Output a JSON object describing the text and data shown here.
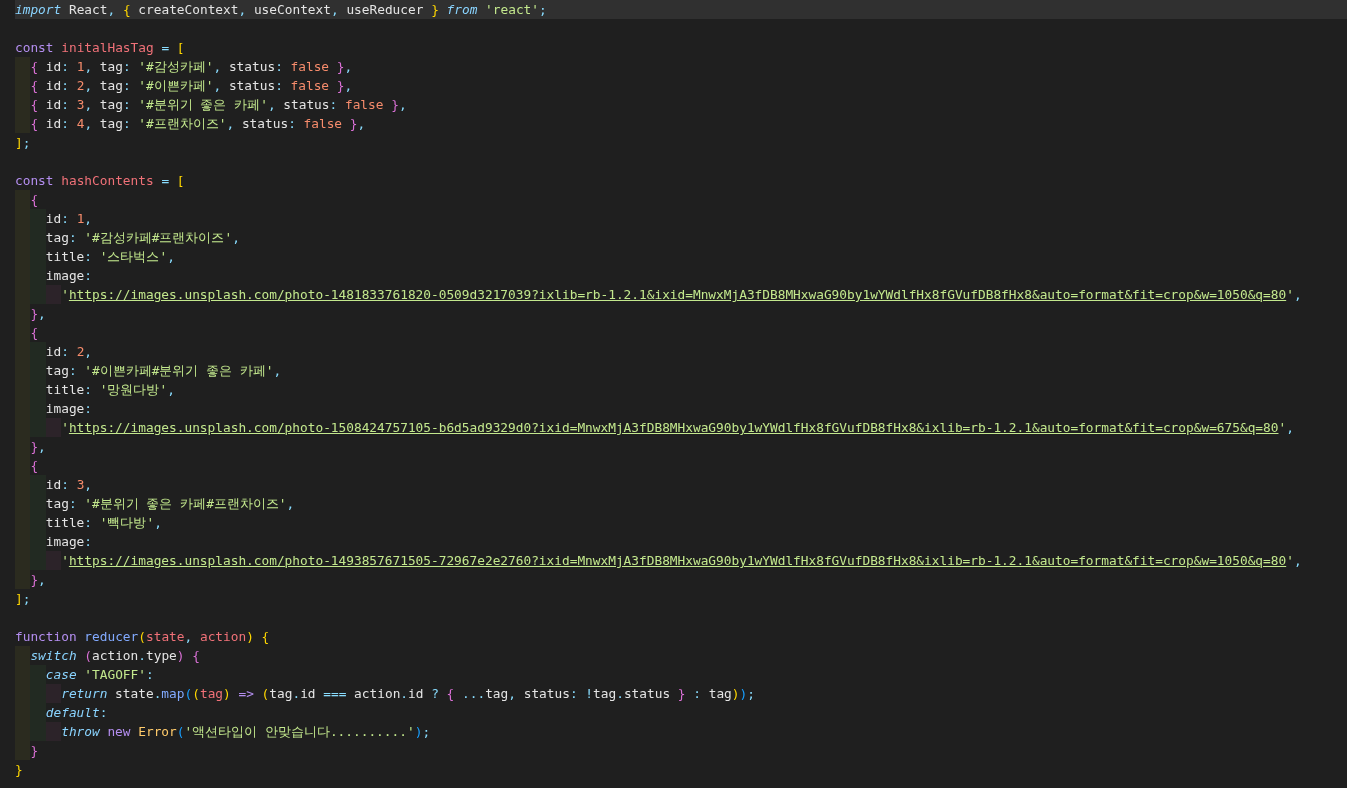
{
  "editor": {
    "lines": [
      {
        "current": true,
        "tokens": [
          {
            "kind": "ctl",
            "text": "import"
          },
          {
            "kind": "text",
            "text": " React"
          },
          {
            "kind": "punc",
            "text": ", "
          },
          {
            "kind": "brk1",
            "text": "{"
          },
          {
            "kind": "text",
            "text": " createContext"
          },
          {
            "kind": "punc",
            "text": ","
          },
          {
            "kind": "text",
            "text": " useContext"
          },
          {
            "kind": "punc",
            "text": ","
          },
          {
            "kind": "text",
            "text": " useReducer "
          },
          {
            "kind": "brk1",
            "text": "}"
          },
          {
            "kind": "ctl",
            "text": " from"
          },
          {
            "kind": "str",
            "text": " 'react'"
          },
          {
            "kind": "punc",
            "text": ";"
          }
        ]
      },
      {
        "current": false
      },
      {
        "current": false,
        "tokens": [
          {
            "kind": "kw",
            "text": "const"
          },
          {
            "kind": "var",
            "text": " initalHasTag"
          },
          {
            "kind": "punc",
            "text": " = "
          },
          {
            "kind": "brk1",
            "text": "["
          }
        ],
        "children": [
          {
            "current": false,
            "tokens": [
              {
                "kind": "brk2",
                "text": "{"
              },
              {
                "kind": "text",
                "text": " id"
              },
              {
                "kind": "punc",
                "text": ": "
              },
              {
                "kind": "num",
                "text": "1"
              },
              {
                "kind": "punc",
                "text": ", "
              },
              {
                "kind": "text",
                "text": "tag"
              },
              {
                "kind": "punc",
                "text": ": "
              },
              {
                "kind": "str",
                "text": "'#감성카페'"
              },
              {
                "kind": "punc",
                "text": ", "
              },
              {
                "kind": "text",
                "text": "status"
              },
              {
                "kind": "punc",
                "text": ": "
              },
              {
                "kind": "num",
                "text": "false "
              },
              {
                "kind": "brk2",
                "text": "}"
              },
              {
                "kind": "punc",
                "text": ","
              }
            ]
          },
          {
            "current": false,
            "tokens": [
              {
                "kind": "brk2",
                "text": "{"
              },
              {
                "kind": "text",
                "text": " id"
              },
              {
                "kind": "punc",
                "text": ": "
              },
              {
                "kind": "num",
                "text": "2"
              },
              {
                "kind": "punc",
                "text": ", "
              },
              {
                "kind": "text",
                "text": "tag"
              },
              {
                "kind": "punc",
                "text": ": "
              },
              {
                "kind": "str",
                "text": "'#이쁜카페'"
              },
              {
                "kind": "punc",
                "text": ", "
              },
              {
                "kind": "text",
                "text": "status"
              },
              {
                "kind": "punc",
                "text": ": "
              },
              {
                "kind": "num",
                "text": "false "
              },
              {
                "kind": "brk2",
                "text": "}"
              },
              {
                "kind": "punc",
                "text": ","
              }
            ]
          },
          {
            "current": false,
            "tokens": [
              {
                "kind": "brk2",
                "text": "{"
              },
              {
                "kind": "text",
                "text": " id"
              },
              {
                "kind": "punc",
                "text": ": "
              },
              {
                "kind": "num",
                "text": "3"
              },
              {
                "kind": "punc",
                "text": ", "
              },
              {
                "kind": "text",
                "text": "tag"
              },
              {
                "kind": "punc",
                "text": ": "
              },
              {
                "kind": "str",
                "text": "'#분위기 좋은 카페'"
              },
              {
                "kind": "punc",
                "text": ", "
              },
              {
                "kind": "text",
                "text": "status"
              },
              {
                "kind": "punc",
                "text": ": "
              },
              {
                "kind": "num",
                "text": "false "
              },
              {
                "kind": "brk2",
                "text": "}"
              },
              {
                "kind": "punc",
                "text": ","
              }
            ]
          },
          {
            "current": false,
            "tokens": [
              {
                "kind": "brk2",
                "text": "{"
              },
              {
                "kind": "text",
                "text": " id"
              },
              {
                "kind": "punc",
                "text": ": "
              },
              {
                "kind": "num",
                "text": "4"
              },
              {
                "kind": "punc",
                "text": ", "
              },
              {
                "kind": "text",
                "text": "tag"
              },
              {
                "kind": "punc",
                "text": ": "
              },
              {
                "kind": "str",
                "text": "'#프랜차이즈'"
              },
              {
                "kind": "punc",
                "text": ", "
              },
              {
                "kind": "text",
                "text": "status"
              },
              {
                "kind": "punc",
                "text": ": "
              },
              {
                "kind": "num",
                "text": "false "
              },
              {
                "kind": "brk2",
                "text": "}"
              },
              {
                "kind": "punc",
                "text": ","
              }
            ]
          }
        ]
      },
      {
        "current": false,
        "tokens": [
          {
            "kind": "brk1",
            "text": "]"
          },
          {
            "kind": "punc",
            "text": ";"
          }
        ]
      },
      {
        "current": false
      },
      {
        "current": false,
        "tokens": [
          {
            "kind": "kw",
            "text": "const"
          },
          {
            "kind": "var",
            "text": " hashContents"
          },
          {
            "kind": "punc",
            "text": " = "
          },
          {
            "kind": "brk1",
            "text": "["
          }
        ],
        "children": [
          {
            "current": false,
            "tokens": [
              {
                "kind": "brk2",
                "text": "{"
              }
            ],
            "children": [
              {
                "current": false,
                "tokens": [
                  {
                    "kind": "text",
                    "text": "id"
                  },
                  {
                    "kind": "punc",
                    "text": ": "
                  },
                  {
                    "kind": "num",
                    "text": "1"
                  },
                  {
                    "kind": "punc",
                    "text": ","
                  }
                ]
              },
              {
                "current": false,
                "tokens": [
                  {
                    "kind": "text",
                    "text": "tag"
                  },
                  {
                    "kind": "punc",
                    "text": ": "
                  },
                  {
                    "kind": "str",
                    "text": "'#감성카페#프랜차이즈'"
                  },
                  {
                    "kind": "punc",
                    "text": ","
                  }
                ]
              },
              {
                "current": false,
                "tokens": [
                  {
                    "kind": "text",
                    "text": "title"
                  },
                  {
                    "kind": "punc",
                    "text": ": "
                  },
                  {
                    "kind": "str",
                    "text": "'스타벅스'"
                  },
                  {
                    "kind": "punc",
                    "text": ","
                  }
                ]
              },
              {
                "current": false,
                "tokens": [
                  {
                    "kind": "text",
                    "text": "image"
                  },
                  {
                    "kind": "punc",
                    "text": ":"
                  }
                ],
                "children": [
                  {
                    "current": false,
                    "tokens": [
                      {
                        "kind": "str",
                        "text": "'"
                      },
                      {
                        "kind": "url",
                        "text": "https://images.unsplash.com/photo-1481833761820-0509d3217039?ixlib=rb-1.2.1&ixid=MnwxMjA3fDB8MHxwaG90by1wYWdlfHx8fGVufDB8fHx8&auto=format&fit=crop&w=1050&q=80"
                      },
                      {
                        "kind": "str",
                        "text": "'"
                      },
                      {
                        "kind": "punc",
                        "text": ","
                      }
                    ]
                  }
                ]
              }
            ]
          },
          {
            "current": false,
            "tokens": [
              {
                "kind": "brk2",
                "text": "}"
              },
              {
                "kind": "punc",
                "text": ","
              }
            ]
          },
          {
            "current": false,
            "tokens": [
              {
                "kind": "brk2",
                "text": "{"
              }
            ],
            "children": [
              {
                "current": false,
                "tokens": [
                  {
                    "kind": "text",
                    "text": "id"
                  },
                  {
                    "kind": "punc",
                    "text": ": "
                  },
                  {
                    "kind": "num",
                    "text": "2"
                  },
                  {
                    "kind": "punc",
                    "text": ","
                  }
                ]
              },
              {
                "current": false,
                "tokens": [
                  {
                    "kind": "text",
                    "text": "tag"
                  },
                  {
                    "kind": "punc",
                    "text": ": "
                  },
                  {
                    "kind": "str",
                    "text": "'#이쁜카페#분위기 좋은 카페'"
                  },
                  {
                    "kind": "punc",
                    "text": ","
                  }
                ]
              },
              {
                "current": false,
                "tokens": [
                  {
                    "kind": "text",
                    "text": "title"
                  },
                  {
                    "kind": "punc",
                    "text": ": "
                  },
                  {
                    "kind": "str",
                    "text": "'망원다방'"
                  },
                  {
                    "kind": "punc",
                    "text": ","
                  }
                ]
              },
              {
                "current": false,
                "tokens": [
                  {
                    "kind": "text",
                    "text": "image"
                  },
                  {
                    "kind": "punc",
                    "text": ":"
                  }
                ],
                "children": [
                  {
                    "current": false,
                    "tokens": [
                      {
                        "kind": "str",
                        "text": "'"
                      },
                      {
                        "kind": "url",
                        "text": "https://images.unsplash.com/photo-1508424757105-b6d5ad9329d0?ixid=MnwxMjA3fDB8MHxwaG90by1wYWdlfHx8fGVufDB8fHx8&ixlib=rb-1.2.1&auto=format&fit=crop&w=675&q=80"
                      },
                      {
                        "kind": "str",
                        "text": "'"
                      },
                      {
                        "kind": "punc",
                        "text": ","
                      }
                    ]
                  }
                ]
              }
            ]
          },
          {
            "current": false,
            "tokens": [
              {
                "kind": "brk2",
                "text": "}"
              },
              {
                "kind": "punc",
                "text": ","
              }
            ]
          },
          {
            "current": false,
            "tokens": [
              {
                "kind": "brk2",
                "text": "{"
              }
            ],
            "children": [
              {
                "current": false,
                "tokens": [
                  {
                    "kind": "text",
                    "text": "id"
                  },
                  {
                    "kind": "punc",
                    "text": ": "
                  },
                  {
                    "kind": "num",
                    "text": "3"
                  },
                  {
                    "kind": "punc",
                    "text": ","
                  }
                ]
              },
              {
                "current": false,
                "tokens": [
                  {
                    "kind": "text",
                    "text": "tag"
                  },
                  {
                    "kind": "punc",
                    "text": ": "
                  },
                  {
                    "kind": "str",
                    "text": "'#분위기 좋은 카페#프랜차이즈'"
                  },
                  {
                    "kind": "punc",
                    "text": ","
                  }
                ]
              },
              {
                "current": false,
                "tokens": [
                  {
                    "kind": "text",
                    "text": "title"
                  },
                  {
                    "kind": "punc",
                    "text": ": "
                  },
                  {
                    "kind": "str",
                    "text": "'빽다방'"
                  },
                  {
                    "kind": "punc",
                    "text": ","
                  }
                ]
              },
              {
                "current": false,
                "tokens": [
                  {
                    "kind": "text",
                    "text": "image"
                  },
                  {
                    "kind": "punc",
                    "text": ":"
                  }
                ],
                "children": [
                  {
                    "current": false,
                    "tokens": [
                      {
                        "kind": "str",
                        "text": "'"
                      },
                      {
                        "kind": "url",
                        "text": "https://images.unsplash.com/photo-1493857671505-72967e2e2760?ixid=MnwxMjA3fDB8MHxwaG90by1wYWdlfHx8fGVufDB8fHx8&ixlib=rb-1.2.1&auto=format&fit=crop&w=1050&q=80"
                      },
                      {
                        "kind": "str",
                        "text": "'"
                      },
                      {
                        "kind": "punc",
                        "text": ","
                      }
                    ]
                  }
                ]
              }
            ]
          },
          {
            "current": false,
            "tokens": [
              {
                "kind": "brk2",
                "text": "}"
              },
              {
                "kind": "punc",
                "text": ","
              }
            ]
          }
        ]
      },
      {
        "current": false,
        "tokens": [
          {
            "kind": "brk1",
            "text": "]"
          },
          {
            "kind": "punc",
            "text": ";"
          }
        ]
      },
      {
        "current": false
      },
      {
        "current": false,
        "tokens": [
          {
            "kind": "kw",
            "text": "function"
          },
          {
            "kind": "fn",
            "text": " reducer"
          },
          {
            "kind": "brk1",
            "text": "("
          },
          {
            "kind": "var",
            "text": "state"
          },
          {
            "kind": "punc",
            "text": ", "
          },
          {
            "kind": "var",
            "text": "action"
          },
          {
            "kind": "brk1",
            "text": ")"
          },
          {
            "kind": "brk1",
            "text": " {"
          }
        ],
        "children": [
          {
            "current": false,
            "tokens": [
              {
                "kind": "ctl",
                "text": "switch"
              },
              {
                "kind": "brk2",
                "text": " ("
              },
              {
                "kind": "text",
                "text": "action"
              },
              {
                "kind": "punc",
                "text": "."
              },
              {
                "kind": "text",
                "text": "type"
              },
              {
                "kind": "brk2",
                "text": ")"
              },
              {
                "kind": "brk2",
                "text": " {"
              }
            ],
            "children": [
              {
                "current": false,
                "tokens": [
                  {
                    "kind": "ctl",
                    "text": "case"
                  },
                  {
                    "kind": "str",
                    "text": " 'TAGOFF'"
                  },
                  {
                    "kind": "punc",
                    "text": ":"
                  }
                ],
                "children": [
                  {
                    "current": false,
                    "tokens": [
                      {
                        "kind": "ctl",
                        "text": "return"
                      },
                      {
                        "kind": "text",
                        "text": " state"
                      },
                      {
                        "kind": "punc",
                        "text": "."
                      },
                      {
                        "kind": "fn",
                        "text": "map"
                      },
                      {
                        "kind": "brk3",
                        "text": "("
                      },
                      {
                        "kind": "brk1",
                        "text": "("
                      },
                      {
                        "kind": "var",
                        "text": "tag"
                      },
                      {
                        "kind": "brk1",
                        "text": ")"
                      },
                      {
                        "kind": "kw",
                        "text": " =>"
                      },
                      {
                        "kind": "brk1",
                        "text": " ("
                      },
                      {
                        "kind": "text",
                        "text": "tag"
                      },
                      {
                        "kind": "punc",
                        "text": "."
                      },
                      {
                        "kind": "text",
                        "text": "id "
                      },
                      {
                        "kind": "punc",
                        "text": "==="
                      },
                      {
                        "kind": "text",
                        "text": " action"
                      },
                      {
                        "kind": "punc",
                        "text": "."
                      },
                      {
                        "kind": "text",
                        "text": "id "
                      },
                      {
                        "kind": "punc",
                        "text": "?"
                      },
                      {
                        "kind": "brk2",
                        "text": " {"
                      },
                      {
                        "kind": "punc",
                        "text": " ..."
                      },
                      {
                        "kind": "text",
                        "text": "tag"
                      },
                      {
                        "kind": "punc",
                        "text": ","
                      },
                      {
                        "kind": "text",
                        "text": " status"
                      },
                      {
                        "kind": "punc",
                        "text": ": !"
                      },
                      {
                        "kind": "text",
                        "text": "tag"
                      },
                      {
                        "kind": "punc",
                        "text": "."
                      },
                      {
                        "kind": "text",
                        "text": "status "
                      },
                      {
                        "kind": "brk2",
                        "text": "}"
                      },
                      {
                        "kind": "punc",
                        "text": " :"
                      },
                      {
                        "kind": "text",
                        "text": " tag"
                      },
                      {
                        "kind": "brk1",
                        "text": ")"
                      },
                      {
                        "kind": "brk3",
                        "text": ")"
                      },
                      {
                        "kind": "punc",
                        "text": ";"
                      }
                    ]
                  }
                ]
              },
              {
                "current": false,
                "tokens": [
                  {
                    "kind": "ctl",
                    "text": "default"
                  },
                  {
                    "kind": "punc",
                    "text": ":"
                  }
                ],
                "children": [
                  {
                    "current": false,
                    "tokens": [
                      {
                        "kind": "ctl",
                        "text": "throw"
                      },
                      {
                        "kind": "kw",
                        "text": " new"
                      },
                      {
                        "kind": "cls",
                        "text": " Error"
                      },
                      {
                        "kind": "brk3",
                        "text": "("
                      },
                      {
                        "kind": "str",
                        "text": "'액션타입이 안맞습니다..........'"
                      },
                      {
                        "kind": "brk3",
                        "text": ")"
                      },
                      {
                        "kind": "punc",
                        "text": ";"
                      }
                    ]
                  }
                ]
              }
            ]
          },
          {
            "current": false,
            "tokens": [
              {
                "kind": "brk2",
                "text": "}"
              }
            ]
          }
        ]
      },
      {
        "current": false,
        "tokens": [
          {
            "kind": "brk1",
            "text": "}"
          }
        ]
      }
    ]
  }
}
